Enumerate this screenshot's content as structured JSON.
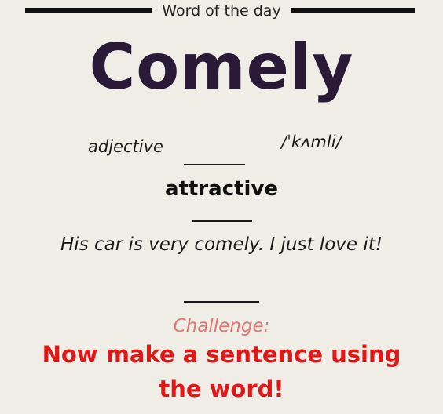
{
  "header": {
    "label": "Word of the day"
  },
  "word": "Comely",
  "part_of_speech": "adjective",
  "pronunciation": "/ˈkʌmli/",
  "meaning": "attractive",
  "example": "His car is very comely. I just love it!",
  "challenge": {
    "label": "Challenge:",
    "text": "Now make a sentence using the word!"
  },
  "colors": {
    "background": "#f0ede6",
    "word": "#2a1a38",
    "challenge_label": "#e07777",
    "challenge_text": "#e01818"
  }
}
